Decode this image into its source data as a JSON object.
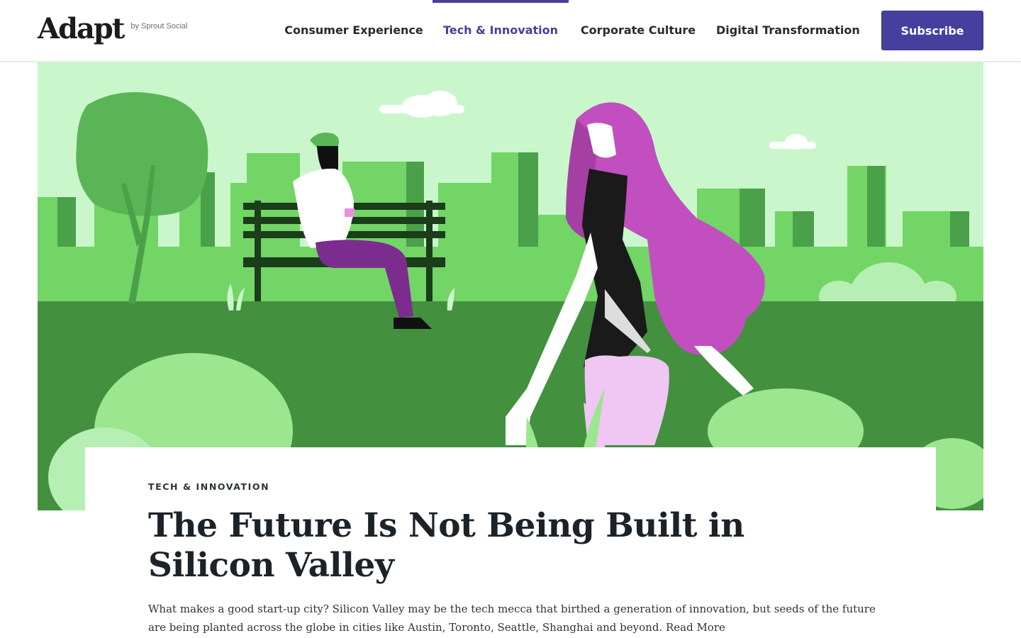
{
  "header": {
    "logo": "Adapt",
    "logo_byline": "by Sprout Social",
    "nav": [
      {
        "label": "Consumer Experience",
        "active": false
      },
      {
        "label": "Tech & Innovation",
        "active": true
      },
      {
        "label": "Corporate Culture",
        "active": false
      },
      {
        "label": "Digital Transformation",
        "active": false
      }
    ],
    "subscribe_label": "Subscribe"
  },
  "article": {
    "category": "TECH & INNOVATION",
    "title": "The Future Is Not Being Built in Silicon Valley",
    "excerpt": "What makes a good start-up city? Silicon Valley may be the tech mecca that birthed a generation of innovation, but seeds of the future are being planted across the globe in cities like Austin, Toronto, Seattle, Shanghai and beyond.",
    "read_more": "Read More"
  },
  "colors": {
    "accent": "#473f9e",
    "sky": "#c9f7cb",
    "ground": "#43903f",
    "building": "#72d566"
  },
  "hero_image": "illustration-park-bench-city-woman-walking"
}
